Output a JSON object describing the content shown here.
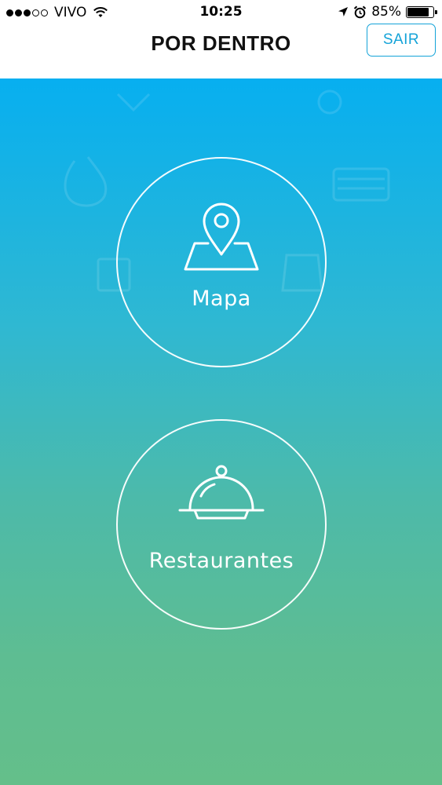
{
  "status_bar": {
    "carrier": "VIVO",
    "time": "10:25",
    "battery_text": "85%",
    "battery_level": 0.85,
    "signal_bars_filled": 3,
    "signal_bars_total": 5,
    "icons": [
      "signal-dots-icon",
      "wifi-icon",
      "location-arrow-icon",
      "alarm-clock-icon",
      "battery-icon"
    ]
  },
  "nav": {
    "title": "POR DENTRO",
    "exit_label": "SAIR",
    "accent_color": "#14a3d8"
  },
  "menu": {
    "items": [
      {
        "label": "Mapa",
        "icon": "map-pin-icon"
      },
      {
        "label": "Restaurantes",
        "icon": "food-cloche-icon"
      }
    ]
  },
  "theme": {
    "gradient_top": "#07aff0",
    "gradient_bottom": "#64bf8a"
  }
}
